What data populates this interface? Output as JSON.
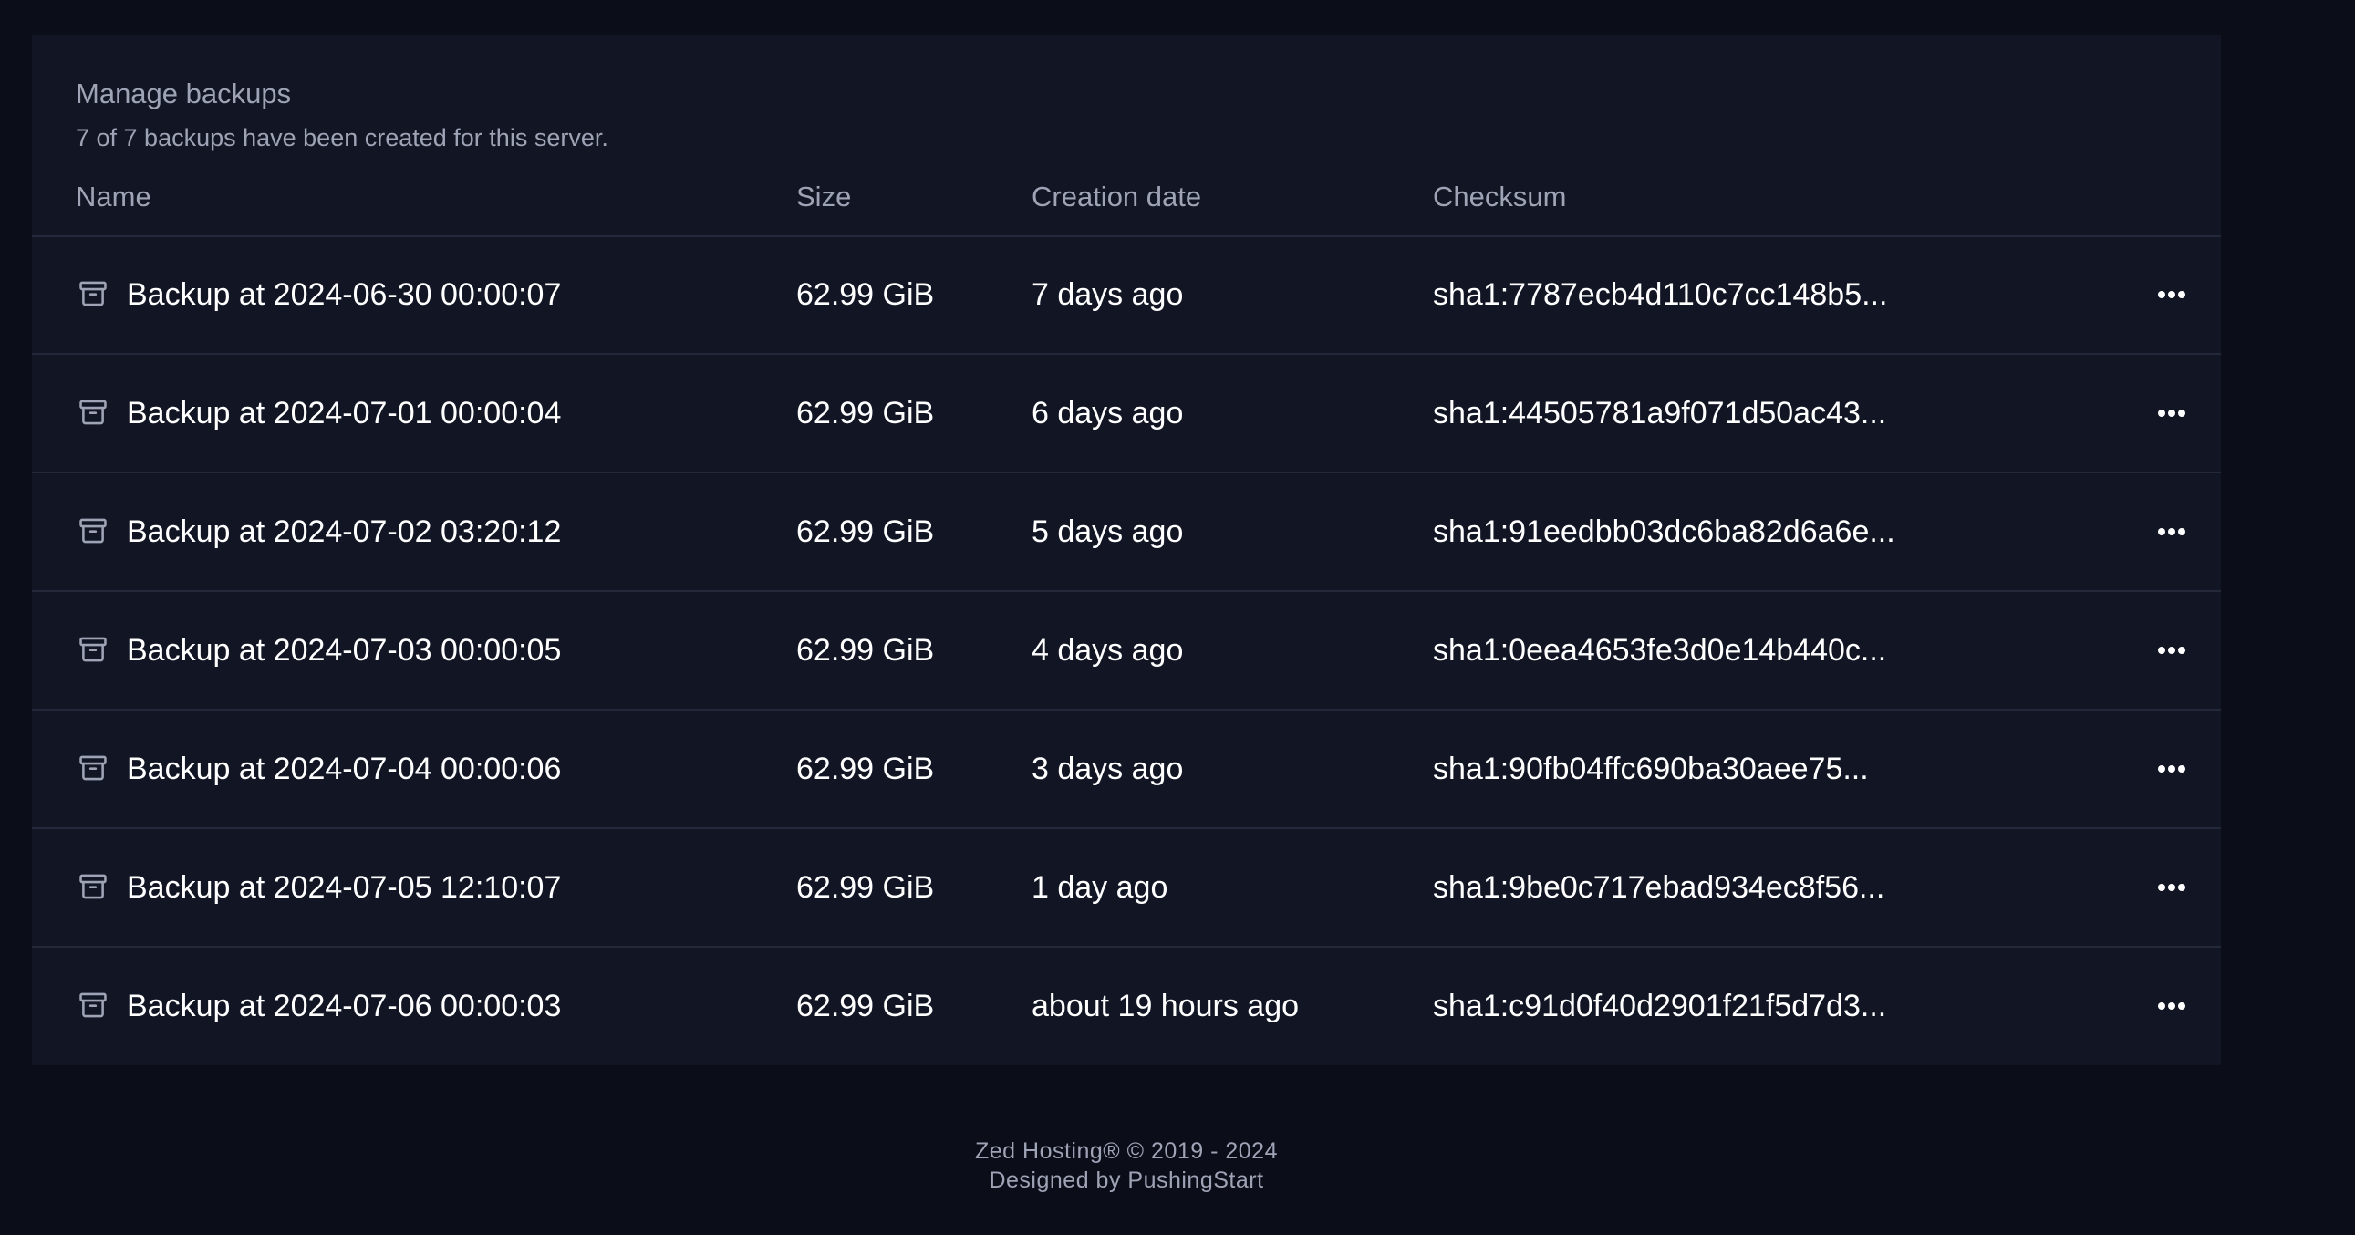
{
  "backups": {
    "title": "Manage backups",
    "subtitle": "7 of 7 backups have been created for this server.",
    "columns": {
      "name": "Name",
      "size": "Size",
      "date": "Creation date",
      "checksum": "Checksum"
    },
    "rows": [
      {
        "name": "Backup at 2024-06-30 00:00:07",
        "size": "62.99 GiB",
        "date": "7 days ago",
        "checksum": "sha1:7787ecb4d110c7cc148b5..."
      },
      {
        "name": "Backup at 2024-07-01 00:00:04",
        "size": "62.99 GiB",
        "date": "6 days ago",
        "checksum": "sha1:44505781a9f071d50ac43..."
      },
      {
        "name": "Backup at 2024-07-02 03:20:12",
        "size": "62.99 GiB",
        "date": "5 days ago",
        "checksum": "sha1:91eedbb03dc6ba82d6a6e..."
      },
      {
        "name": "Backup at 2024-07-03 00:00:05",
        "size": "62.99 GiB",
        "date": "4 days ago",
        "checksum": "sha1:0eea4653fe3d0e14b440c..."
      },
      {
        "name": "Backup at 2024-07-04 00:00:06",
        "size": "62.99 GiB",
        "date": "3 days ago",
        "checksum": "sha1:90fb04ffc690ba30aee75..."
      },
      {
        "name": "Backup at 2024-07-05 12:10:07",
        "size": "62.99 GiB",
        "date": "1 day ago",
        "checksum": "sha1:9be0c717ebad934ec8f56..."
      },
      {
        "name": "Backup at 2024-07-06 00:00:03",
        "size": "62.99 GiB",
        "date": "about 19 hours ago",
        "checksum": "sha1:c91d0f40d2901f21f5d7d3..."
      }
    ],
    "row_icon": "archive-icon",
    "row_action_icon": "ellipsis-horizontal-icon"
  },
  "footer": {
    "copyright": "Zed Hosting® © 2019 - 2024",
    "credit": "Designed by PushingStart"
  },
  "colors": {
    "page_background": "#0b0d19",
    "panel_background": "#121624",
    "muted_text": "#9ea3b5",
    "divider": "#23283a",
    "text": "#ffffff"
  }
}
